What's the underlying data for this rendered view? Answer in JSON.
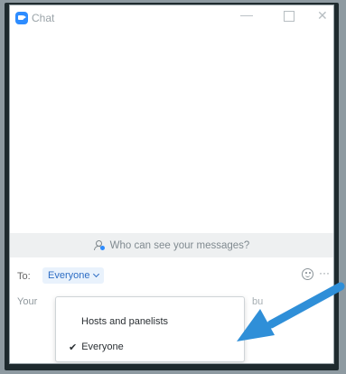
{
  "window": {
    "title": "Chat"
  },
  "info_bar": {
    "text": "Who can see your messages?"
  },
  "to_row": {
    "label": "To:",
    "recipient": "Everyone"
  },
  "compose": {
    "placeholder_left": "Your",
    "placeholder_right": "bu"
  },
  "dropdown": {
    "items": [
      {
        "label": "Hosts and panelists",
        "checked": false
      },
      {
        "label": "Everyone",
        "checked": true
      }
    ]
  },
  "colors": {
    "accent": "#2d8cff",
    "arrow": "#2f8fd8"
  },
  "icons": [
    "zoom-app-icon",
    "minimize-icon",
    "maximize-icon",
    "close-icon",
    "people-icon",
    "chevron-down-icon",
    "emoji-icon",
    "more-icon",
    "checkmark-icon",
    "pointer-arrow"
  ]
}
